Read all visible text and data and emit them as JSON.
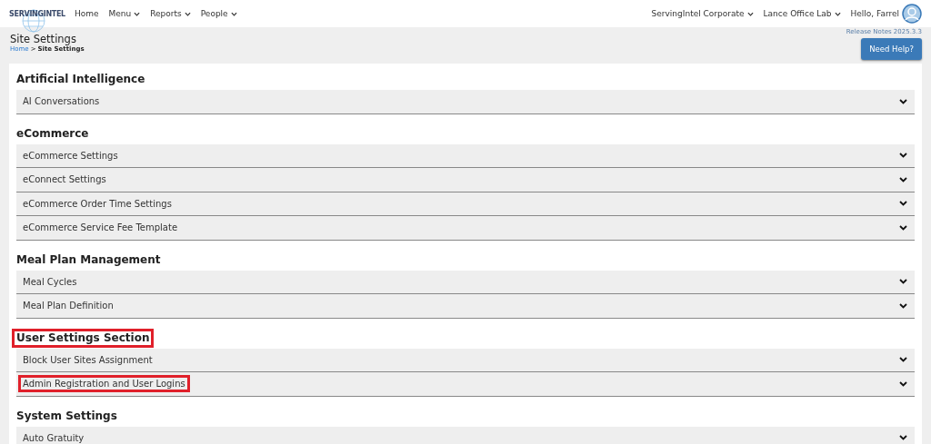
{
  "header": {
    "logo": "SERVINGINTEL",
    "nav": [
      {
        "label": "Home",
        "dropdown": false
      },
      {
        "label": "Menu",
        "dropdown": true
      },
      {
        "label": "Reports",
        "dropdown": true
      },
      {
        "label": "People",
        "dropdown": true
      }
    ],
    "right": [
      {
        "label": "ServingIntel Corporate",
        "dropdown": true
      },
      {
        "label": "Lance Office Lab",
        "dropdown": true
      }
    ],
    "greeting": "Hello, Farrel"
  },
  "page": {
    "title": "Site Settings",
    "breadcrumb": [
      {
        "label": "Home",
        "link": true
      },
      {
        "label": "Site Settings",
        "link": false
      }
    ],
    "breadcrumb_separator": ">",
    "release_notes": "Release Notes 2025.3.3",
    "help_button": "Need Help?"
  },
  "sections": [
    {
      "title": "Artificial Intelligence",
      "highlighted": false,
      "items": [
        {
          "label": "AI Conversations",
          "highlighted": false
        }
      ]
    },
    {
      "title": "eCommerce",
      "highlighted": false,
      "items": [
        {
          "label": "eCommerce Settings",
          "highlighted": false
        },
        {
          "label": "eConnect Settings",
          "highlighted": false
        },
        {
          "label": "eCommerce Order Time Settings",
          "highlighted": false
        },
        {
          "label": "eCommerce Service Fee Template",
          "highlighted": false
        }
      ]
    },
    {
      "title": "Meal Plan Management",
      "highlighted": false,
      "items": [
        {
          "label": "Meal Cycles",
          "highlighted": false
        },
        {
          "label": "Meal Plan Definition",
          "highlighted": false
        }
      ]
    },
    {
      "title": "User Settings Section",
      "highlighted": true,
      "items": [
        {
          "label": "Block User Sites Assignment",
          "highlighted": false
        },
        {
          "label": "Admin Registration and User Logins",
          "highlighted": true
        }
      ]
    },
    {
      "title": "System Settings",
      "highlighted": false,
      "items": [
        {
          "label": "Auto Gratuity",
          "highlighted": false
        }
      ]
    }
  ]
}
